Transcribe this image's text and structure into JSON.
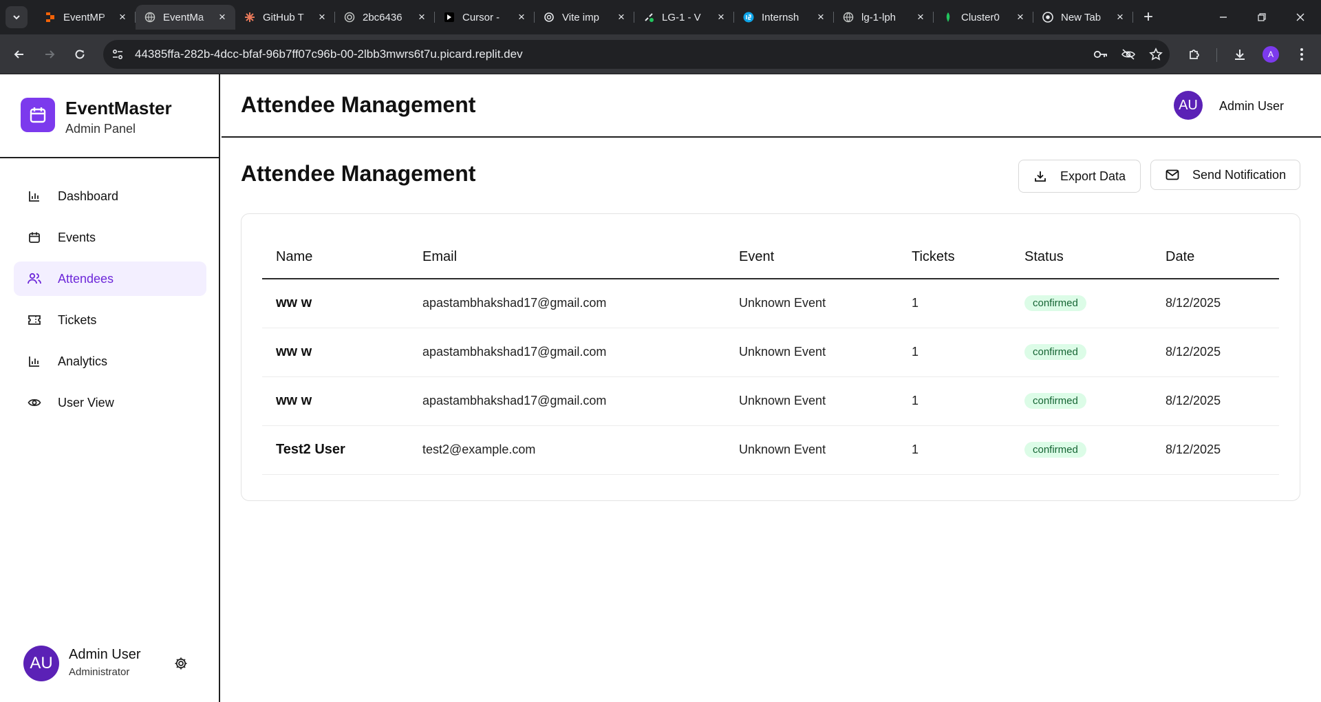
{
  "browser": {
    "tabs": [
      {
        "title": "EventMP",
        "active": false
      },
      {
        "title": "EventMa",
        "active": true
      },
      {
        "title": "GitHub T",
        "active": false
      },
      {
        "title": "2bc6436",
        "active": false
      },
      {
        "title": "Cursor -",
        "active": false
      },
      {
        "title": "Vite imp",
        "active": false
      },
      {
        "title": "LG-1 - V",
        "active": false
      },
      {
        "title": "Internsh",
        "active": false
      },
      {
        "title": "lg-1-lph",
        "active": false
      },
      {
        "title": "Cluster0",
        "active": false
      },
      {
        "title": "New Tab",
        "active": false
      }
    ],
    "url": "44385ffa-282b-4dcc-bfaf-96b7ff07c96b-00-2lbb3mwrs6t7u.picard.replit.dev",
    "profile_initial": "A"
  },
  "sidebar": {
    "brand_name": "EventMaster",
    "brand_sub": "Admin Panel",
    "items": [
      {
        "label": "Dashboard",
        "icon": "bar-chart-icon",
        "active": false
      },
      {
        "label": "Events",
        "icon": "calendar-icon",
        "active": false
      },
      {
        "label": "Attendees",
        "icon": "users-icon",
        "active": true
      },
      {
        "label": "Tickets",
        "icon": "ticket-icon",
        "active": false
      },
      {
        "label": "Analytics",
        "icon": "bar-chart-icon",
        "active": false
      },
      {
        "label": "User View",
        "icon": "eye-icon",
        "active": false
      }
    ],
    "user": {
      "initials": "AU",
      "name": "Admin User",
      "role": "Administrator"
    }
  },
  "header": {
    "title": "Attendee Management",
    "user_initials": "AU",
    "user_name": "Admin User"
  },
  "main": {
    "title": "Attendee Management",
    "export_label": "Export Data",
    "notify_label": "Send Notification",
    "table": {
      "columns": [
        "Name",
        "Email",
        "Event",
        "Tickets",
        "Status",
        "Date"
      ],
      "rows": [
        {
          "name": "ww w",
          "email": "apastambhakshad17@gmail.com",
          "event": "Unknown Event",
          "tickets": "1",
          "status": "confirmed",
          "date": "8/12/2025"
        },
        {
          "name": "ww w",
          "email": "apastambhakshad17@gmail.com",
          "event": "Unknown Event",
          "tickets": "1",
          "status": "confirmed",
          "date": "8/12/2025"
        },
        {
          "name": "ww w",
          "email": "apastambhakshad17@gmail.com",
          "event": "Unknown Event",
          "tickets": "1",
          "status": "confirmed",
          "date": "8/12/2025"
        },
        {
          "name": "Test2 User",
          "email": "test2@example.com",
          "event": "Unknown Event",
          "tickets": "1",
          "status": "confirmed",
          "date": "8/12/2025"
        }
      ]
    }
  },
  "colors": {
    "accent": "#7c3aed",
    "avatar": "#5b21b6",
    "badge_bg": "#dcfce7",
    "badge_text": "#166534",
    "active_nav_bg": "#f3efff"
  }
}
